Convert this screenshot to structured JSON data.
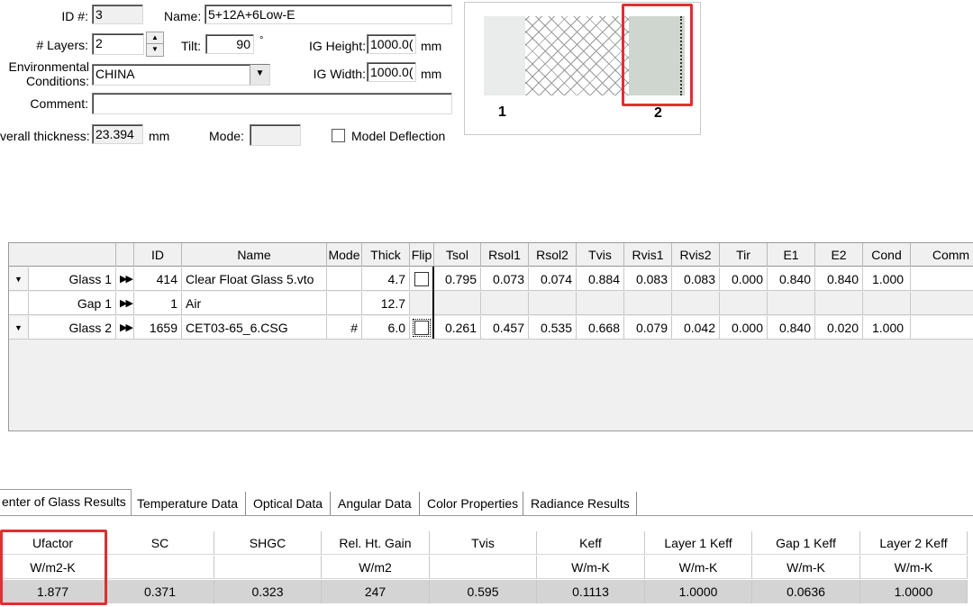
{
  "form": {
    "id_label": "ID #:",
    "id_value": "3",
    "name_label": "Name:",
    "name_value": "5+12A+6Low-E",
    "layers_label": "# Layers:",
    "layers_value": "2",
    "tilt_label": "Tilt:",
    "tilt_value": "90",
    "tilt_unit": "°",
    "ig_height_label": "IG Height:",
    "ig_height_value": "1000.0(",
    "ig_height_unit": "mm",
    "env_label_1": "Environmental",
    "env_label_2": "Conditions:",
    "env_value": "CHINA",
    "ig_width_label": "IG Width:",
    "ig_width_value": "1000.0(",
    "ig_width_unit": "mm",
    "comment_label": "Comment:",
    "comment_value": "",
    "overall_label": "verall thickness:",
    "overall_value": "23.394",
    "overall_unit": "mm",
    "mode_label": "Mode:",
    "mode_value": "",
    "model_deflection_label": "Model Deflection",
    "model_deflection_checked": false
  },
  "preview": {
    "pane1_label": "1",
    "pane2_label": "2"
  },
  "grid": {
    "headers": [
      "",
      "",
      "ID",
      "Name",
      "Mode",
      "Thick",
      "Flip",
      "Tsol",
      "Rsol1",
      "Rsol2",
      "Tvis",
      "Rvis1",
      "Rvis2",
      "Tir",
      "E1",
      "E2",
      "Cond",
      "Comm"
    ],
    "rows": [
      {
        "dd": "▼",
        "layer": "Glass 1",
        "ff": "▶▶",
        "id": "414",
        "name": "Clear Float Glass 5.vto",
        "mode": "",
        "thick": "4.7",
        "flip": true,
        "tsol": "0.795",
        "rsol1": "0.073",
        "rsol2": "0.074",
        "tvis": "0.884",
        "rvis1": "0.083",
        "rvis2": "0.083",
        "tir": "0.000",
        "e1": "0.840",
        "e2": "0.840",
        "cond": "1.000"
      },
      {
        "dd": "",
        "layer": "Gap 1",
        "ff": "▶▶",
        "id": "1",
        "name": "Air",
        "mode": "",
        "thick": "12.7",
        "flip": false,
        "tsol": "",
        "rsol1": "",
        "rsol2": "",
        "tvis": "",
        "rvis1": "",
        "rvis2": "",
        "tir": "",
        "e1": "",
        "e2": "",
        "cond": ""
      },
      {
        "dd": "▼",
        "layer": "Glass 2",
        "ff": "▶▶",
        "id": "1659",
        "name": "CET03-65_6.CSG",
        "mode": "#",
        "thick": "6.0",
        "flip": true,
        "tsol": "0.261",
        "rsol1": "0.457",
        "rsol2": "0.535",
        "tvis": "0.668",
        "rvis1": "0.079",
        "rvis2": "0.042",
        "tir": "0.000",
        "e1": "0.840",
        "e2": "0.020",
        "cond": "1.000"
      }
    ]
  },
  "tabs": [
    "enter of Glass Results",
    "Temperature Data",
    "Optical Data",
    "Angular Data",
    "Color Properties",
    "Radiance Results"
  ],
  "results": {
    "headers": [
      "Ufactor",
      "SC",
      "SHGC",
      "Rel. Ht. Gain",
      "Tvis",
      "Keff",
      "Layer 1 Keff",
      "Gap 1 Keff",
      "Layer 2 Keff"
    ],
    "units": [
      "W/m2-K",
      "",
      "",
      "W/m2",
      "",
      "W/m-K",
      "W/m-K",
      "W/m-K",
      "W/m-K"
    ],
    "values": [
      "1.877",
      "0.371",
      "0.323",
      "247",
      "0.595",
      "0.1113",
      "1.0000",
      "0.0636",
      "1.0000"
    ]
  },
  "colors": {
    "highlight": "#e03030"
  }
}
